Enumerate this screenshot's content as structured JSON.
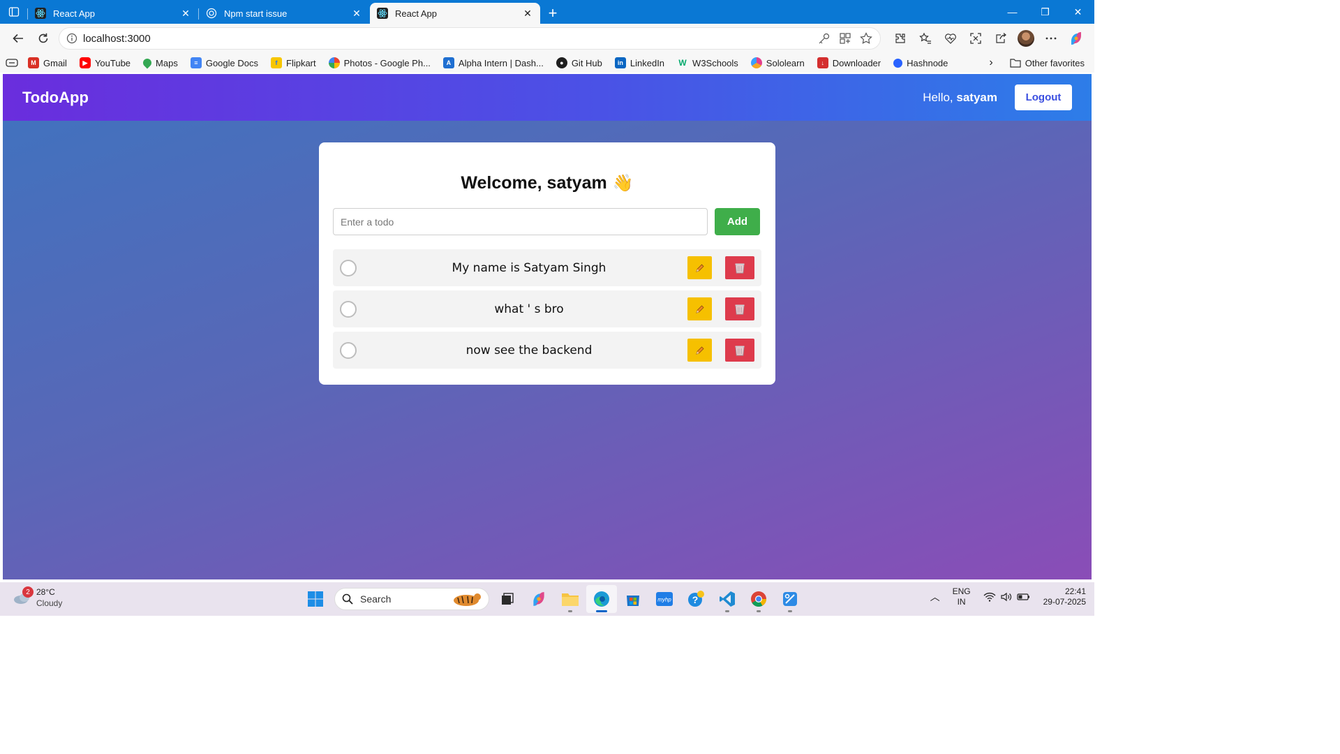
{
  "browser": {
    "tabs": [
      {
        "title": "React App",
        "icon": "react-icon",
        "active": false
      },
      {
        "title": "Npm start issue",
        "icon": "chatgpt-icon",
        "active": false
      },
      {
        "title": "React App",
        "icon": "react-icon",
        "active": true
      }
    ],
    "url": "localhost:3000",
    "favorites": [
      {
        "label": "Gmail",
        "icon": "gmail-icon",
        "color": "#d93025"
      },
      {
        "label": "YouTube",
        "icon": "youtube-icon",
        "color": "#ff0000"
      },
      {
        "label": "Maps",
        "icon": "maps-icon",
        "color": "#34a853"
      },
      {
        "label": "Google Docs",
        "icon": "docs-icon",
        "color": "#4285f4"
      },
      {
        "label": "Flipkart",
        "icon": "flipkart-icon",
        "color": "#f7c600"
      },
      {
        "label": "Photos - Google Ph...",
        "icon": "photos-icon",
        "color": "#fbbc04"
      },
      {
        "label": "Alpha Intern | Dash...",
        "icon": "alpha-icon",
        "color": "#1f6fd1"
      },
      {
        "label": "Git Hub",
        "icon": "github-icon",
        "color": "#1f1f1f"
      },
      {
        "label": "LinkedIn",
        "icon": "linkedin-icon",
        "color": "#0a66c2"
      },
      {
        "label": "W3Schools",
        "icon": "w3schools-icon",
        "color": "#04aa6d"
      },
      {
        "label": "Sololearn",
        "icon": "sololearn-icon",
        "color": "#e3408d"
      },
      {
        "label": "Downloader",
        "icon": "downloader-icon",
        "color": "#d42f2f"
      },
      {
        "label": "Hashnode",
        "icon": "hashnode-icon",
        "color": "#2962ff"
      }
    ],
    "other_favorites": "Other favorites"
  },
  "app": {
    "brand": "TodoApp",
    "hello_prefix": "Hello,",
    "username": "satyam",
    "logout_label": "Logout",
    "welcome": "Welcome, satyam",
    "wave": "👋",
    "input_placeholder": "Enter a todo",
    "add_label": "Add",
    "todos": [
      {
        "text": "My name is Satyam Singh",
        "completed": false
      },
      {
        "text": "what ' s bro",
        "completed": false
      },
      {
        "text": "now see the backend",
        "completed": false
      }
    ],
    "colors": {
      "add": "#3fae4a",
      "edit": "#f6c000",
      "delete": "#de3b4c"
    }
  },
  "taskbar": {
    "weather_badge": "2",
    "temperature": "28°C",
    "condition": "Cloudy",
    "search_placeholder": "Search",
    "lang_line1": "ENG",
    "lang_line2": "IN",
    "time": "22:41",
    "date": "29-07-2025"
  }
}
